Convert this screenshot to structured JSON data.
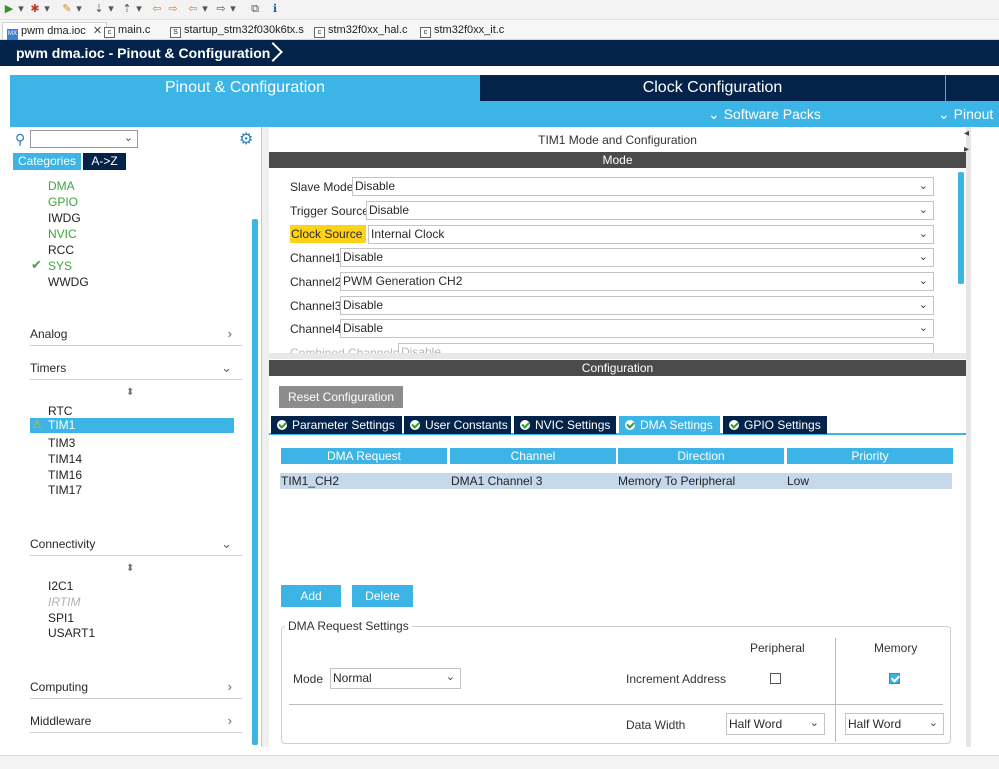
{
  "file_tabs": [
    {
      "label": "pwm dma.ioc",
      "badge": "MX",
      "closable": true,
      "active": true
    },
    {
      "label": "main.c",
      "badge": "c"
    },
    {
      "label": "startup_stm32f030k6tx.s",
      "badge": "S"
    },
    {
      "label": "stm32f0xx_hal.c",
      "badge": "c"
    },
    {
      "label": "stm32f0xx_it.c",
      "badge": "c"
    }
  ],
  "breadcrumb": "pwm dma.ioc - Pinout & Configuration",
  "main_tabs": [
    "Pinout & Configuration",
    "Clock Configuration"
  ],
  "sub_links": [
    "Software Packs",
    "Pinout"
  ],
  "left": {
    "tabs": [
      "Categories",
      "A->Z"
    ],
    "system_items": [
      {
        "label": "DMA",
        "color": "#3da63a"
      },
      {
        "label": "GPIO",
        "color": "#3da63a"
      },
      {
        "label": "IWDG",
        "color": "#222222"
      },
      {
        "label": "NVIC",
        "color": "#3da63a"
      },
      {
        "label": "RCC",
        "color": "#222222"
      },
      {
        "label": "SYS",
        "color": "#3da63a",
        "checked": true
      },
      {
        "label": "WWDG",
        "color": "#222222"
      }
    ],
    "sections": {
      "analog": "Analog",
      "timers": "Timers",
      "connectivity": "Connectivity",
      "computing": "Computing",
      "middleware": "Middleware"
    },
    "timer_items": [
      "RTC",
      "TIM1",
      "TIM3",
      "TIM14",
      "TIM16",
      "TIM17"
    ],
    "selected_timer": "TIM1",
    "connectivity_items": [
      "I2C1",
      "IRTIM",
      "SPI1",
      "USART1"
    ]
  },
  "mode": {
    "panel_title": "TIM1 Mode and Configuration",
    "header": "Mode",
    "rows": [
      {
        "label": "Slave Mode",
        "value": "Disable"
      },
      {
        "label": "Trigger Source",
        "value": "Disable"
      },
      {
        "label": "Clock Source",
        "value": "Internal Clock",
        "highlight": true
      },
      {
        "label": "Channel1",
        "value": "Disable"
      },
      {
        "label": "Channel2",
        "value": "PWM Generation CH2"
      },
      {
        "label": "Channel3",
        "value": "Disable"
      },
      {
        "label": "Channel4",
        "value": "Disable"
      },
      {
        "label": "Combined Channels",
        "value": "Disable"
      }
    ]
  },
  "config": {
    "header": "Configuration",
    "reset_label": "Reset Configuration",
    "tabs": [
      "Parameter Settings",
      "User Constants",
      "NVIC Settings",
      "DMA Settings",
      "GPIO Settings"
    ],
    "active_tab": "DMA Settings",
    "table_headers": [
      "DMA Request",
      "Channel",
      "Direction",
      "Priority"
    ],
    "table_rows": [
      [
        "TIM1_CH2",
        "DMA1 Channel 3",
        "Memory To Peripheral",
        "Low"
      ]
    ],
    "add_label": "Add",
    "delete_label": "Delete",
    "settings": {
      "group_title": "DMA Request Settings",
      "peripheral": "Peripheral",
      "memory": "Memory",
      "mode_label": "Mode",
      "mode_value": "Normal",
      "increment_label": "Increment Address",
      "peripheral_increment": false,
      "memory_increment": true,
      "data_width_label": "Data Width",
      "peripheral_width": "Half Word",
      "memory_width": "Half Word"
    }
  },
  "colors": {
    "navy": "#03234b",
    "accent": "#3cb4e6",
    "green": "#3da63a",
    "highlight": "#ffd21a"
  }
}
